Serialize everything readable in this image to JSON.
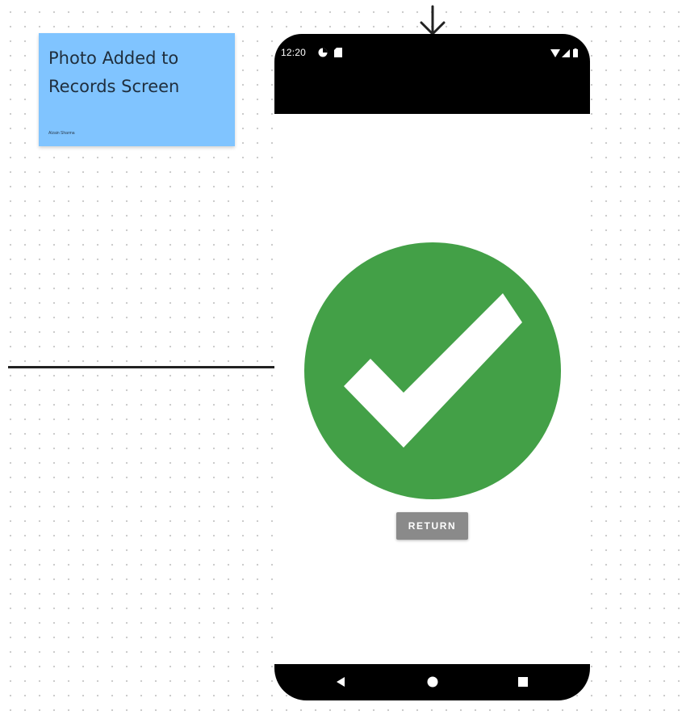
{
  "sticky_note": {
    "title": "Photo Added to Records Screen",
    "author": "Alzain Sharma",
    "color": "#80c4ff"
  },
  "phone": {
    "status_bar": {
      "time": "12:20"
    },
    "success_color": "#43a047",
    "return_button": {
      "label": "RETURN",
      "color": "#8a8a8a"
    },
    "nav_bar": {
      "icons": [
        "back-icon",
        "home-icon",
        "recents-icon"
      ]
    }
  }
}
